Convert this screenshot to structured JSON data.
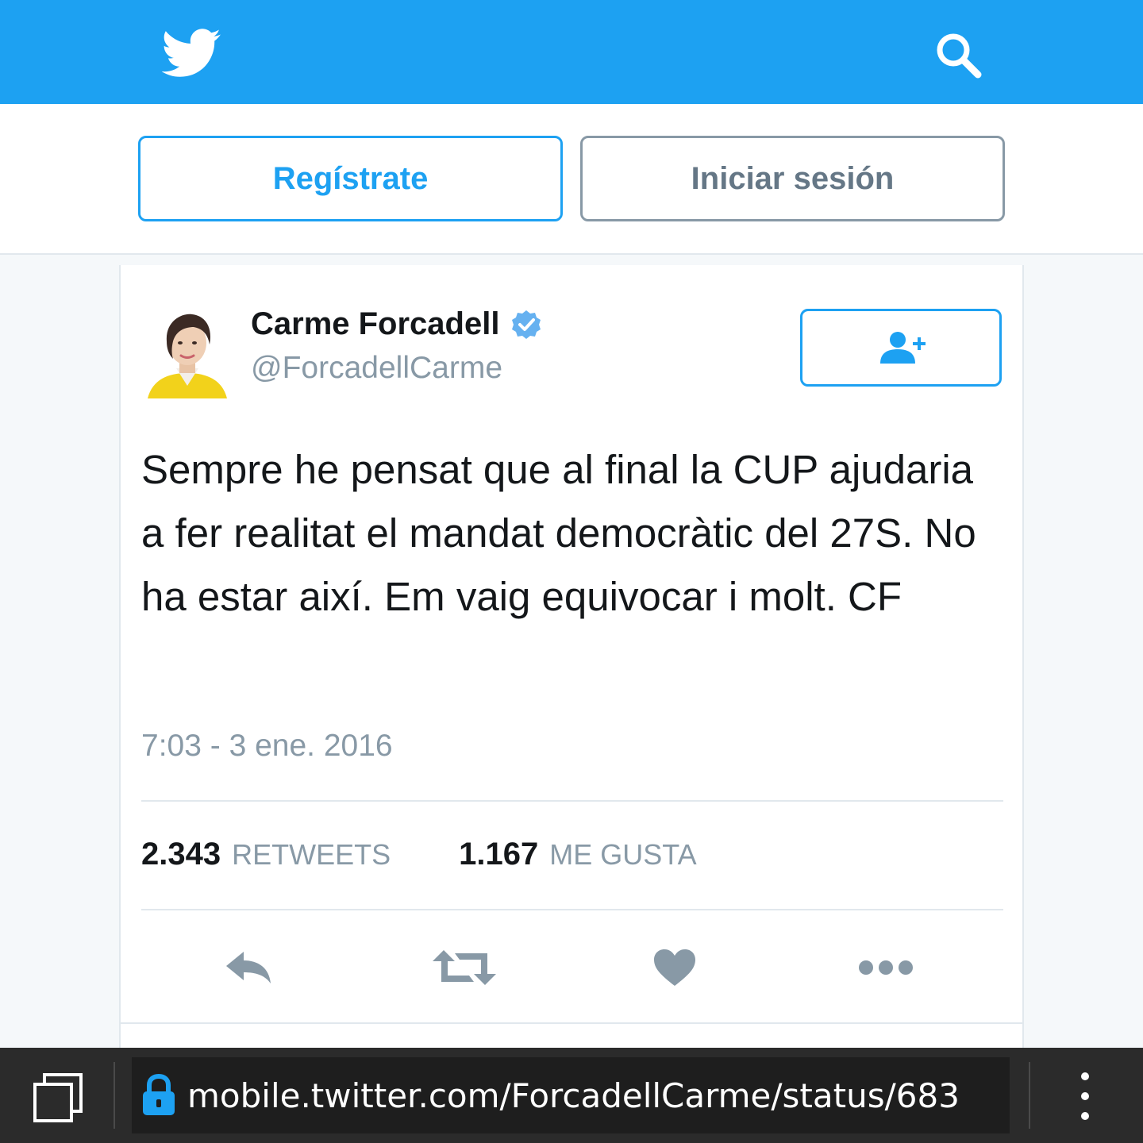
{
  "header": {
    "logo_icon": "twitter-bird-icon",
    "search_icon": "search-icon",
    "color": "#1da1f2"
  },
  "auth": {
    "signup_label": "Regístrate",
    "login_label": "Iniciar sesión"
  },
  "tweet": {
    "author_name": "Carme Forcadell",
    "verified": true,
    "handle": "@ForcadellCarme",
    "follow_icon": "add-user-icon",
    "text": "Sempre he pensat que al final la CUP ajudaria a fer realitat el mandat democràtic del 27S. No ha estar així. Em vaig equivocar i molt. CF",
    "timestamp": "7:03 - 3 ene. 2016",
    "stats": {
      "retweets_count": "2.343",
      "retweets_label": "RETWEETS",
      "likes_count": "1.167",
      "likes_label": "ME GUSTA"
    },
    "actions": [
      "reply-icon",
      "retweet-icon",
      "heart-icon",
      "more-icon"
    ]
  },
  "browser": {
    "url": "mobile.twitter.com/ForcadellCarme/status/683",
    "tabs_icon": "tabs-icon",
    "lock_icon": "lock-icon",
    "menu_icon": "kebab-menu-icon"
  }
}
